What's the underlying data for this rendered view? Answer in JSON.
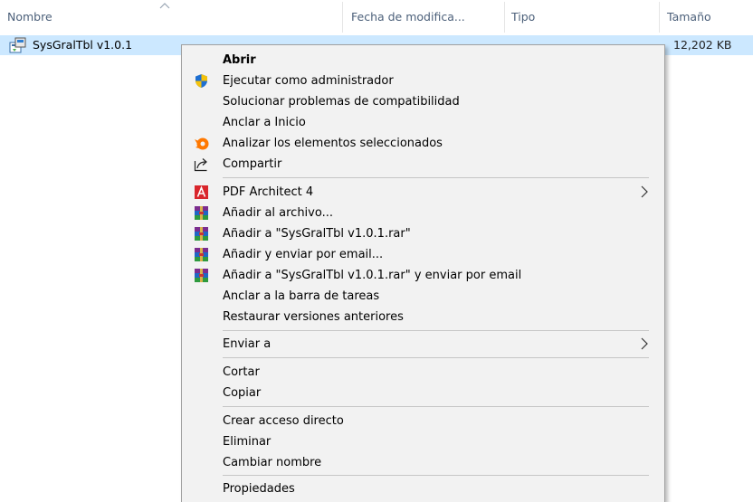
{
  "columns": {
    "name": "Nombre",
    "modified": "Fecha de modifica...",
    "type": "Tipo",
    "size": "Tamaño"
  },
  "file": {
    "name": "SysGralTbl v1.0.1",
    "size": "12,202 KB"
  },
  "menu": {
    "open": "Abrir",
    "run_as_admin": "Ejecutar como administrador",
    "troubleshoot": "Solucionar problemas de compatibilidad",
    "pin_start": "Anclar a Inicio",
    "scan": "Analizar los elementos seleccionados",
    "share": "Compartir",
    "pdf_architect": "PDF Architect 4",
    "add_archive": "Añadir al archivo...",
    "add_rar": "Añadir a \"SysGralTbl v1.0.1.rar\"",
    "add_email": "Añadir y enviar por email...",
    "add_rar_email": "Añadir a \"SysGralTbl v1.0.1.rar\" y enviar por email",
    "pin_taskbar": "Anclar a la barra de tareas",
    "restore_versions": "Restaurar versiones anteriores",
    "send_to": "Enviar a",
    "cut": "Cortar",
    "copy": "Copiar",
    "create_shortcut": "Crear acceso directo",
    "delete": "Eliminar",
    "rename": "Cambiar nombre",
    "properties": "Propiedades"
  },
  "icons": {
    "shield": "uac-shield-icon",
    "avast": "avast-icon",
    "share": "share-icon",
    "pdf": "pdf-architect-icon",
    "winrar": "winrar-icon",
    "submenu": "chevron-right-icon"
  },
  "colors": {
    "selection": "#cce8ff",
    "menu_bg": "#f2f2f2",
    "header_text": "#4c607a"
  }
}
